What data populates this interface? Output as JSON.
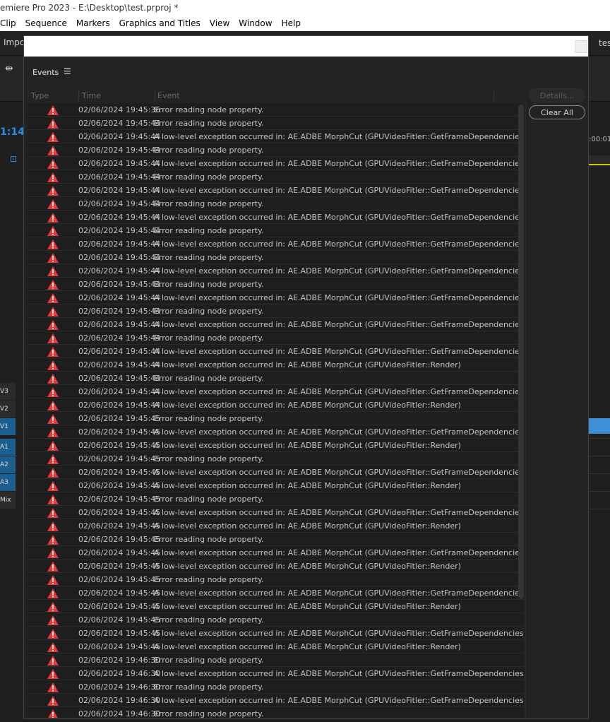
{
  "window": {
    "title": "emiere Pro 2023 - E:\\Desktop\\test.prproj *",
    "menu": [
      "Clip",
      "Sequence",
      "Markers",
      "Graphics and Titles",
      "View",
      "Window",
      "Help"
    ]
  },
  "app": {
    "import_label": "Impo",
    "timecode": "1:14",
    "right_tab_label": "tes",
    "right_timecode": ":00:01",
    "tracks": [
      "V3",
      "V2",
      "V1",
      "A1",
      "A2",
      "A3",
      "Mix"
    ]
  },
  "dialog": {
    "panel_title": "Events",
    "panel_menu_icon": "hamburger-icon",
    "columns": [
      "Type",
      "Time",
      "Event"
    ],
    "details_label": "Details...",
    "clear_all_label": "Clear All",
    "rows": [
      {
        "time": "02/06/2024 19:45:36",
        "event": "Error reading node property."
      },
      {
        "time": "02/06/2024 19:45:44",
        "event": "Error reading node property."
      },
      {
        "time": "02/06/2024 19:45:44",
        "event": "A low-level exception occurred in: AE.ADBE MorphCut (GPUVideoFitler::GetFrameDependencies)"
      },
      {
        "time": "02/06/2024 19:45:44",
        "event": "Error reading node property."
      },
      {
        "time": "02/06/2024 19:45:44",
        "event": "A low-level exception occurred in: AE.ADBE MorphCut (GPUVideoFitler::GetFrameDependencies)"
      },
      {
        "time": "02/06/2024 19:45:44",
        "event": "Error reading node property."
      },
      {
        "time": "02/06/2024 19:45:44",
        "event": "A low-level exception occurred in: AE.ADBE MorphCut (GPUVideoFitler::GetFrameDependencies)"
      },
      {
        "time": "02/06/2024 19:45:44",
        "event": "Error reading node property."
      },
      {
        "time": "02/06/2024 19:45:44",
        "event": "A low-level exception occurred in: AE.ADBE MorphCut (GPUVideoFitler::GetFrameDependencies)"
      },
      {
        "time": "02/06/2024 19:45:44",
        "event": "Error reading node property."
      },
      {
        "time": "02/06/2024 19:45:44",
        "event": "A low-level exception occurred in: AE.ADBE MorphCut (GPUVideoFitler::GetFrameDependencies)"
      },
      {
        "time": "02/06/2024 19:45:44",
        "event": "Error reading node property."
      },
      {
        "time": "02/06/2024 19:45:44",
        "event": "A low-level exception occurred in: AE.ADBE MorphCut (GPUVideoFitler::GetFrameDependencies)"
      },
      {
        "time": "02/06/2024 19:45:44",
        "event": "Error reading node property."
      },
      {
        "time": "02/06/2024 19:45:44",
        "event": "A low-level exception occurred in: AE.ADBE MorphCut (GPUVideoFitler::GetFrameDependencies)"
      },
      {
        "time": "02/06/2024 19:45:44",
        "event": "Error reading node property."
      },
      {
        "time": "02/06/2024 19:45:44",
        "event": "A low-level exception occurred in: AE.ADBE MorphCut (GPUVideoFitler::GetFrameDependencies)"
      },
      {
        "time": "02/06/2024 19:45:44",
        "event": "Error reading node property."
      },
      {
        "time": "02/06/2024 19:45:44",
        "event": "A low-level exception occurred in: AE.ADBE MorphCut (GPUVideoFitler::GetFrameDependencies)"
      },
      {
        "time": "02/06/2024 19:45:44",
        "event": "A low-level exception occurred in: AE.ADBE MorphCut (GPUVideoFitler::Render)"
      },
      {
        "time": "02/06/2024 19:45:44",
        "event": "Error reading node property."
      },
      {
        "time": "02/06/2024 19:45:44",
        "event": "A low-level exception occurred in: AE.ADBE MorphCut (GPUVideoFitler::GetFrameDependencies)"
      },
      {
        "time": "02/06/2024 19:45:44",
        "event": "A low-level exception occurred in: AE.ADBE MorphCut (GPUVideoFitler::Render)"
      },
      {
        "time": "02/06/2024 19:45:45",
        "event": "Error reading node property."
      },
      {
        "time": "02/06/2024 19:45:45",
        "event": "A low-level exception occurred in: AE.ADBE MorphCut (GPUVideoFitler::GetFrameDependencies)"
      },
      {
        "time": "02/06/2024 19:45:45",
        "event": "A low-level exception occurred in: AE.ADBE MorphCut (GPUVideoFitler::Render)"
      },
      {
        "time": "02/06/2024 19:45:45",
        "event": "Error reading node property."
      },
      {
        "time": "02/06/2024 19:45:45",
        "event": "A low-level exception occurred in: AE.ADBE MorphCut (GPUVideoFitler::GetFrameDependencies)"
      },
      {
        "time": "02/06/2024 19:45:45",
        "event": "A low-level exception occurred in: AE.ADBE MorphCut (GPUVideoFitler::Render)"
      },
      {
        "time": "02/06/2024 19:45:45",
        "event": "Error reading node property."
      },
      {
        "time": "02/06/2024 19:45:45",
        "event": "A low-level exception occurred in: AE.ADBE MorphCut (GPUVideoFitler::GetFrameDependencies)"
      },
      {
        "time": "02/06/2024 19:45:45",
        "event": "A low-level exception occurred in: AE.ADBE MorphCut (GPUVideoFitler::Render)"
      },
      {
        "time": "02/06/2024 19:45:45",
        "event": "Error reading node property."
      },
      {
        "time": "02/06/2024 19:45:45",
        "event": "A low-level exception occurred in: AE.ADBE MorphCut (GPUVideoFitler::GetFrameDependencies)"
      },
      {
        "time": "02/06/2024 19:45:45",
        "event": "A low-level exception occurred in: AE.ADBE MorphCut (GPUVideoFitler::Render)"
      },
      {
        "time": "02/06/2024 19:45:45",
        "event": "Error reading node property."
      },
      {
        "time": "02/06/2024 19:45:45",
        "event": "A low-level exception occurred in: AE.ADBE MorphCut (GPUVideoFitler::GetFrameDependencies)"
      },
      {
        "time": "02/06/2024 19:45:45",
        "event": "A low-level exception occurred in: AE.ADBE MorphCut (GPUVideoFitler::Render)"
      },
      {
        "time": "02/06/2024 19:45:45",
        "event": "Error reading node property."
      },
      {
        "time": "02/06/2024 19:45:45",
        "event": "A low-level exception occurred in: AE.ADBE MorphCut (GPUVideoFitler::GetFrameDependencies)"
      },
      {
        "time": "02/06/2024 19:45:45",
        "event": "A low-level exception occurred in: AE.ADBE MorphCut (GPUVideoFitler::Render)"
      },
      {
        "time": "02/06/2024 19:46:30",
        "event": "Error reading node property."
      },
      {
        "time": "02/06/2024 19:46:30",
        "event": "A low-level exception occurred in: AE.ADBE MorphCut (GPUVideoFitler::GetFrameDependencies)"
      },
      {
        "time": "02/06/2024 19:46:30",
        "event": "Error reading node property."
      },
      {
        "time": "02/06/2024 19:46:30",
        "event": "A low-level exception occurred in: AE.ADBE MorphCut (GPUVideoFitler::GetFrameDependencies)"
      },
      {
        "time": "02/06/2024 19:46:30",
        "event": "Error reading node property."
      }
    ]
  },
  "colors": {
    "error_icon": "#e03a3a",
    "timecode_blue": "#2d8ceb",
    "track_blue": "#1c5f8f",
    "clip_blue": "#3d8fd6",
    "playhead_yellow": "#d6c400"
  }
}
